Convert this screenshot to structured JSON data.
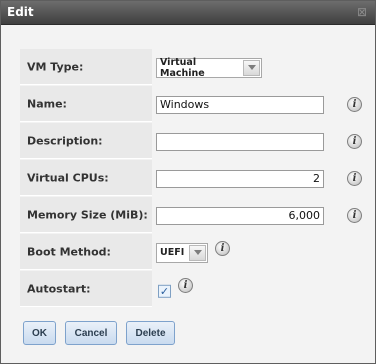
{
  "dialog": {
    "title": "Edit",
    "close_glyph": "⊠"
  },
  "form": {
    "vm_type": {
      "label": "VM Type:",
      "value": "Virtual Machine"
    },
    "name": {
      "label": "Name:",
      "value": "Windows",
      "info": "i"
    },
    "description": {
      "label": "Description:",
      "value": "",
      "info": "i"
    },
    "vcpus": {
      "label": "Virtual CPUs:",
      "value": "2",
      "info": "i"
    },
    "memory": {
      "label": "Memory Size (MiB):",
      "value": "6,000",
      "info": "i"
    },
    "boot_method": {
      "label": "Boot Method:",
      "value": "UEFI",
      "info": "i"
    },
    "autostart": {
      "label": "Autostart:",
      "checked": true,
      "check_glyph": "✓",
      "info": "i"
    }
  },
  "buttons": {
    "ok": "OK",
    "cancel": "Cancel",
    "delete": "Delete"
  },
  "colors": {
    "titlebar": "#4f4f4f",
    "label_bg": "#e9e9e9",
    "button_border": "#7ea2cc"
  }
}
